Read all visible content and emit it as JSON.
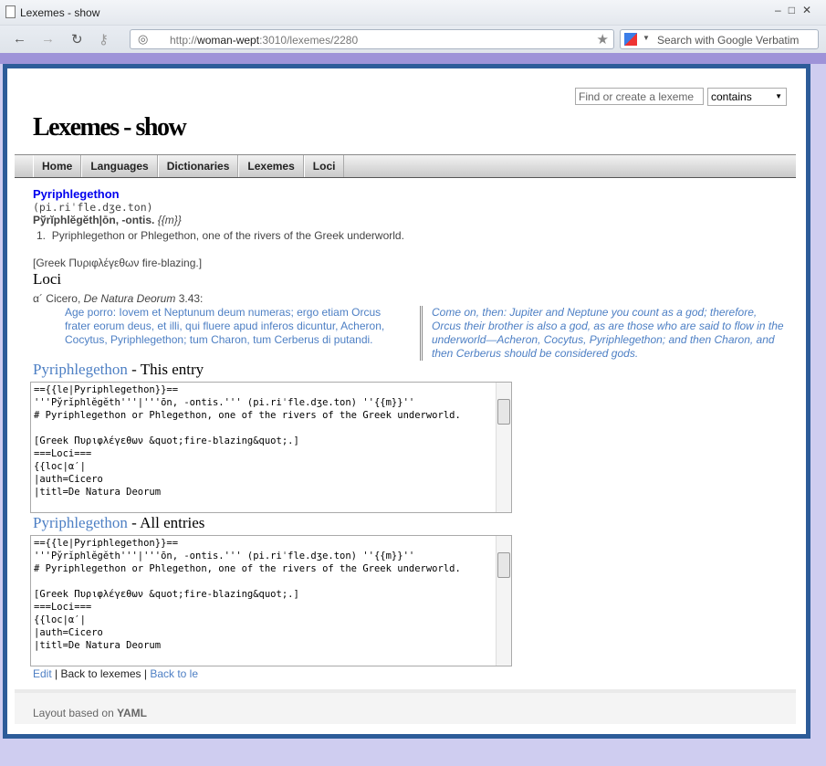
{
  "browser": {
    "tab_title": "Lexemes - show",
    "url_prefix": "http://",
    "url_host": "woman-wept",
    "url_rest": ":3010/lexemes/2280",
    "search_placeholder": "Search with Google Verbatim"
  },
  "header": {
    "search_placeholder": "Find or create a lexeme",
    "select_value": "contains",
    "title": "Lexemes - show"
  },
  "nav": [
    "Home",
    "Languages",
    "Dictionaries",
    "Lexemes",
    "Loci"
  ],
  "entry": {
    "lemma": "Pyriphlegethon",
    "pron": "(pi.riˈfle.dʒe.ton)",
    "headword": "Pўrĭphlĕgĕth|ōn, -ontis.",
    "gender": "{{m}}",
    "sense_num": "1.",
    "sense": "Pyriphlegethon or Phlegethon, one of the rivers of the Greek underworld.",
    "etym": "[Greek Πυριφλέγεθων fire-blazing.]",
    "loci_heading": "Loci",
    "locus": {
      "mark": "α´",
      "author": "Cicero,",
      "work": "De Natura Deorum",
      "ref": "3.43:",
      "latin": "Age porro: Iovem et Neptunum deum numeras; ergo etiam Orcus frater eorum deus, et illi, qui fluere apud inferos dicuntur, Acheron, Cocytus, Pyriphlegethon; tum Charon, tum Cerberus di putandi.",
      "english": "Come on, then: Jupiter and Neptune you count as a god; therefore, Orcus their brother is also a god, as are those who are said to flow in the underworld—Acheron, Cocytus, Pyriphlegethon; and then Charon, and then Cerberus should be considered gods."
    }
  },
  "this_entry": {
    "link": "Pyriphlegethon",
    "label": "- This entry",
    "source": "=={{le|Pyriphlegethon}}==\n'''Pўrĭphlĕgĕth'''|'''ōn, -ontis.''' (pi.riˈfle.dʒe.ton) ''{{m}}''\n# Pyriphlegethon or Phlegethon, one of the rivers of the Greek underworld.\n\n[Greek Πυριφλέγεθων &quot;fire-blazing&quot;.]\n===Loci===\n{{loc|α′|\n|auth=Cicero\n|titl=De Natura Deorum"
  },
  "all_entries": {
    "link": "Pyriphlegethon",
    "label": "- All entries",
    "source": "=={{le|Pyriphlegethon}}==\n'''Pўrĭphlĕgĕth'''|'''ōn, -ontis.''' (pi.riˈfle.dʒe.ton) ''{{m}}''\n# Pyriphlegethon or Phlegethon, one of the rivers of the Greek underworld.\n\n[Greek Πυριφλέγεθων &quot;fire-blazing&quot;.]\n===Loci===\n{{loc|α′|\n|auth=Cicero\n|titl=De Natura Deorum"
  },
  "links": {
    "edit": "Edit",
    "sep1": " | ",
    "back_lexemes": "Back to lexemes",
    "sep2": " | ",
    "back_le": "Back to le"
  },
  "footer": {
    "prefix": "Layout based on ",
    "brand": "YAML"
  }
}
